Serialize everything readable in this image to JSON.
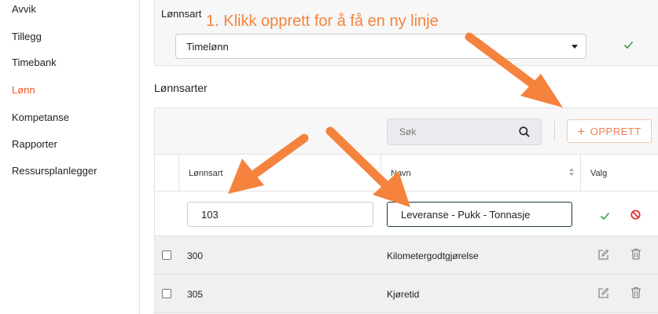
{
  "sidebar": {
    "items": [
      {
        "label": "Avvik",
        "active": false
      },
      {
        "label": "Tillegg",
        "active": false
      },
      {
        "label": "Timebank",
        "active": false
      },
      {
        "label": "Lønn",
        "active": true
      },
      {
        "label": "Kompetanse",
        "active": false
      },
      {
        "label": "Rapporter",
        "active": false
      },
      {
        "label": "Ressursplanlegger",
        "active": false
      }
    ]
  },
  "top_section": {
    "label": "Lønnsart",
    "select_value": "Timelønn",
    "confirm_icon": "check-icon"
  },
  "list_section": {
    "title": "Lønnsarter",
    "search_placeholder": "Søk",
    "create_label": "OPPRETT",
    "columns": {
      "lonnsart": "Lønnsart",
      "navn": "Navn",
      "valg": "Valg"
    },
    "new_row": {
      "lonnsart": "103",
      "navn": "Leveranse - Pukk - Tonnasje"
    },
    "rows": [
      {
        "lonnsart": "300",
        "navn": "Kilometergodtgjørelse"
      },
      {
        "lonnsart": "305",
        "navn": "Kjøretid"
      }
    ]
  },
  "annotation": {
    "text": "1. Klikk opprett for å få en ny linje",
    "color": "#f5833d"
  },
  "colors": {
    "accent": "#f05a28",
    "success": "#2e9e4f",
    "danger": "#e02828"
  }
}
